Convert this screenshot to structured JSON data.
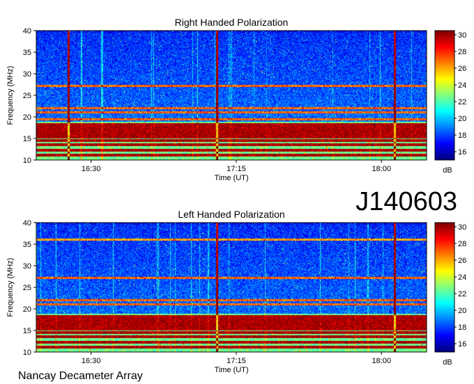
{
  "figure": {
    "id_label": "J140603",
    "footer_label": "Nancay Decameter Array"
  },
  "chart_data": [
    {
      "type": "heatmap",
      "title": "Right Handed Polarization",
      "xlabel": "Time (UT)",
      "ylabel": "Frequency (MHz)",
      "x_ticks": [
        "16:30",
        "17:15",
        "18:00"
      ],
      "x_range": [
        "16:13",
        "18:14"
      ],
      "y_ticks": [
        10,
        15,
        20,
        25,
        30,
        35,
        40
      ],
      "ylim": [
        10,
        40
      ],
      "colorbar": {
        "label": "dB",
        "ticks": [
          16,
          18,
          20,
          22,
          24,
          26,
          28,
          30
        ],
        "range": [
          15,
          30.5
        ],
        "colormap": "jet"
      },
      "features": {
        "saturated_bands_mhz": [
          11.2,
          12.3,
          13.6,
          14.6,
          15.4,
          16.1,
          16.8,
          17.5,
          18.2
        ],
        "bright_lines_mhz": [
          27.3,
          22.1,
          21.2,
          19.5
        ],
        "vertical_lines": [
          "16:23",
          "17:09",
          "18:04"
        ]
      }
    },
    {
      "type": "heatmap",
      "title": "Left Handed Polarization",
      "xlabel": "Time (UT)",
      "ylabel": "Frequency (MHz)",
      "x_ticks": [
        "16:30",
        "17:15",
        "18:00"
      ],
      "x_range": [
        "16:13",
        "18:14"
      ],
      "y_ticks": [
        10,
        15,
        20,
        25,
        30,
        35,
        40
      ],
      "ylim": [
        10,
        40
      ],
      "colorbar": {
        "label": "dB",
        "ticks": [
          16,
          18,
          20,
          22,
          24,
          26,
          28,
          30
        ],
        "range": [
          15,
          30.5
        ],
        "colormap": "jet"
      },
      "features": {
        "saturated_bands_mhz": [
          11.2,
          12.3,
          13.6,
          14.6,
          15.4,
          16.1,
          16.8,
          17.5,
          18.2
        ],
        "bright_lines_mhz": [
          27.3,
          22.1,
          21.2,
          36.1
        ],
        "vertical_lines": [
          "17:09",
          "18:04"
        ]
      }
    }
  ]
}
